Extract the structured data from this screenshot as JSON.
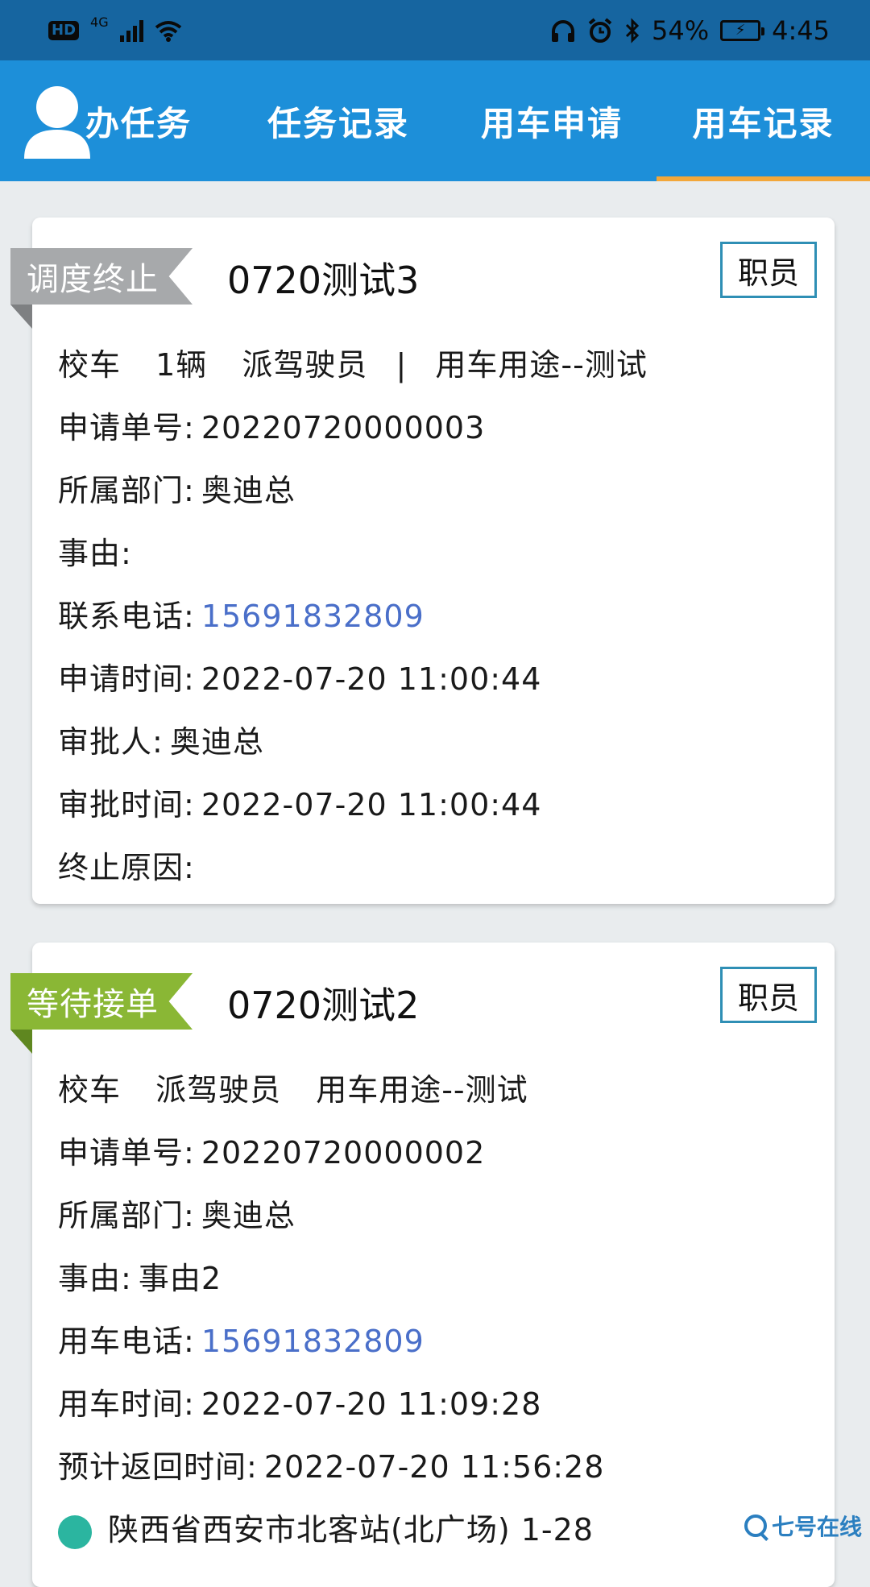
{
  "status_bar": {
    "hd": "HD",
    "network": "4G",
    "battery_percent": "54%",
    "time": "4:45",
    "icons": [
      "signal-icon",
      "wifi-icon",
      "headphones-icon",
      "alarm-icon",
      "bluetooth-icon",
      "battery-charging-icon"
    ]
  },
  "tabs": [
    {
      "label": "办任务",
      "active": false
    },
    {
      "label": "任务记录",
      "active": false
    },
    {
      "label": "用车申请",
      "active": false
    },
    {
      "label": "用车记录",
      "active": true
    }
  ],
  "colors": {
    "header_blue": "#1d8fd9",
    "tab_indicator": "#f3a73a",
    "ribbon_gray": "#a7a9ab",
    "ribbon_green": "#8ab735",
    "phone_link": "#4a6fc9",
    "location_dot": "#2bb5a0"
  },
  "records": [
    {
      "status": "调度终止",
      "title": "0720测试3",
      "role": "职员",
      "summary": {
        "vehicle": "校车",
        "count": "1辆",
        "driver": "派驾驶员",
        "separator": "|",
        "purpose": "用车用途--测试"
      },
      "fields": [
        {
          "label": "申请单号:",
          "value": "20220720000003"
        },
        {
          "label": "所属部门:",
          "value": "奥迪总"
        },
        {
          "label": "事由:",
          "value": ""
        },
        {
          "label": "联系电话:",
          "value": "15691832809"
        },
        {
          "label": "申请时间:",
          "value": "2022-07-20 11:00:44"
        },
        {
          "label": "审批人:",
          "value": "奥迪总"
        },
        {
          "label": "审批时间:",
          "value": "2022-07-20 11:00:44"
        },
        {
          "label": "终止原因:",
          "value": ""
        }
      ]
    },
    {
      "status": "等待接单",
      "title": "0720测试2",
      "role": "职员",
      "summary": {
        "vehicle": "校车",
        "driver": "派驾驶员",
        "purpose": "用车用途--测试"
      },
      "fields": [
        {
          "label": "申请单号:",
          "value": "20220720000002"
        },
        {
          "label": "所属部门:",
          "value": "奥迪总"
        },
        {
          "label": "事由:",
          "value": "事由2"
        },
        {
          "label": "用车电话:",
          "value": "15691832809"
        },
        {
          "label": "用车时间:",
          "value": "2022-07-20 11:09:28"
        },
        {
          "label": "预计返回时间:",
          "value": "2022-07-20 11:56:28"
        }
      ],
      "location": "陕西省西安市北客站(北广场) 1-28"
    }
  ],
  "watermark": "七号在线"
}
